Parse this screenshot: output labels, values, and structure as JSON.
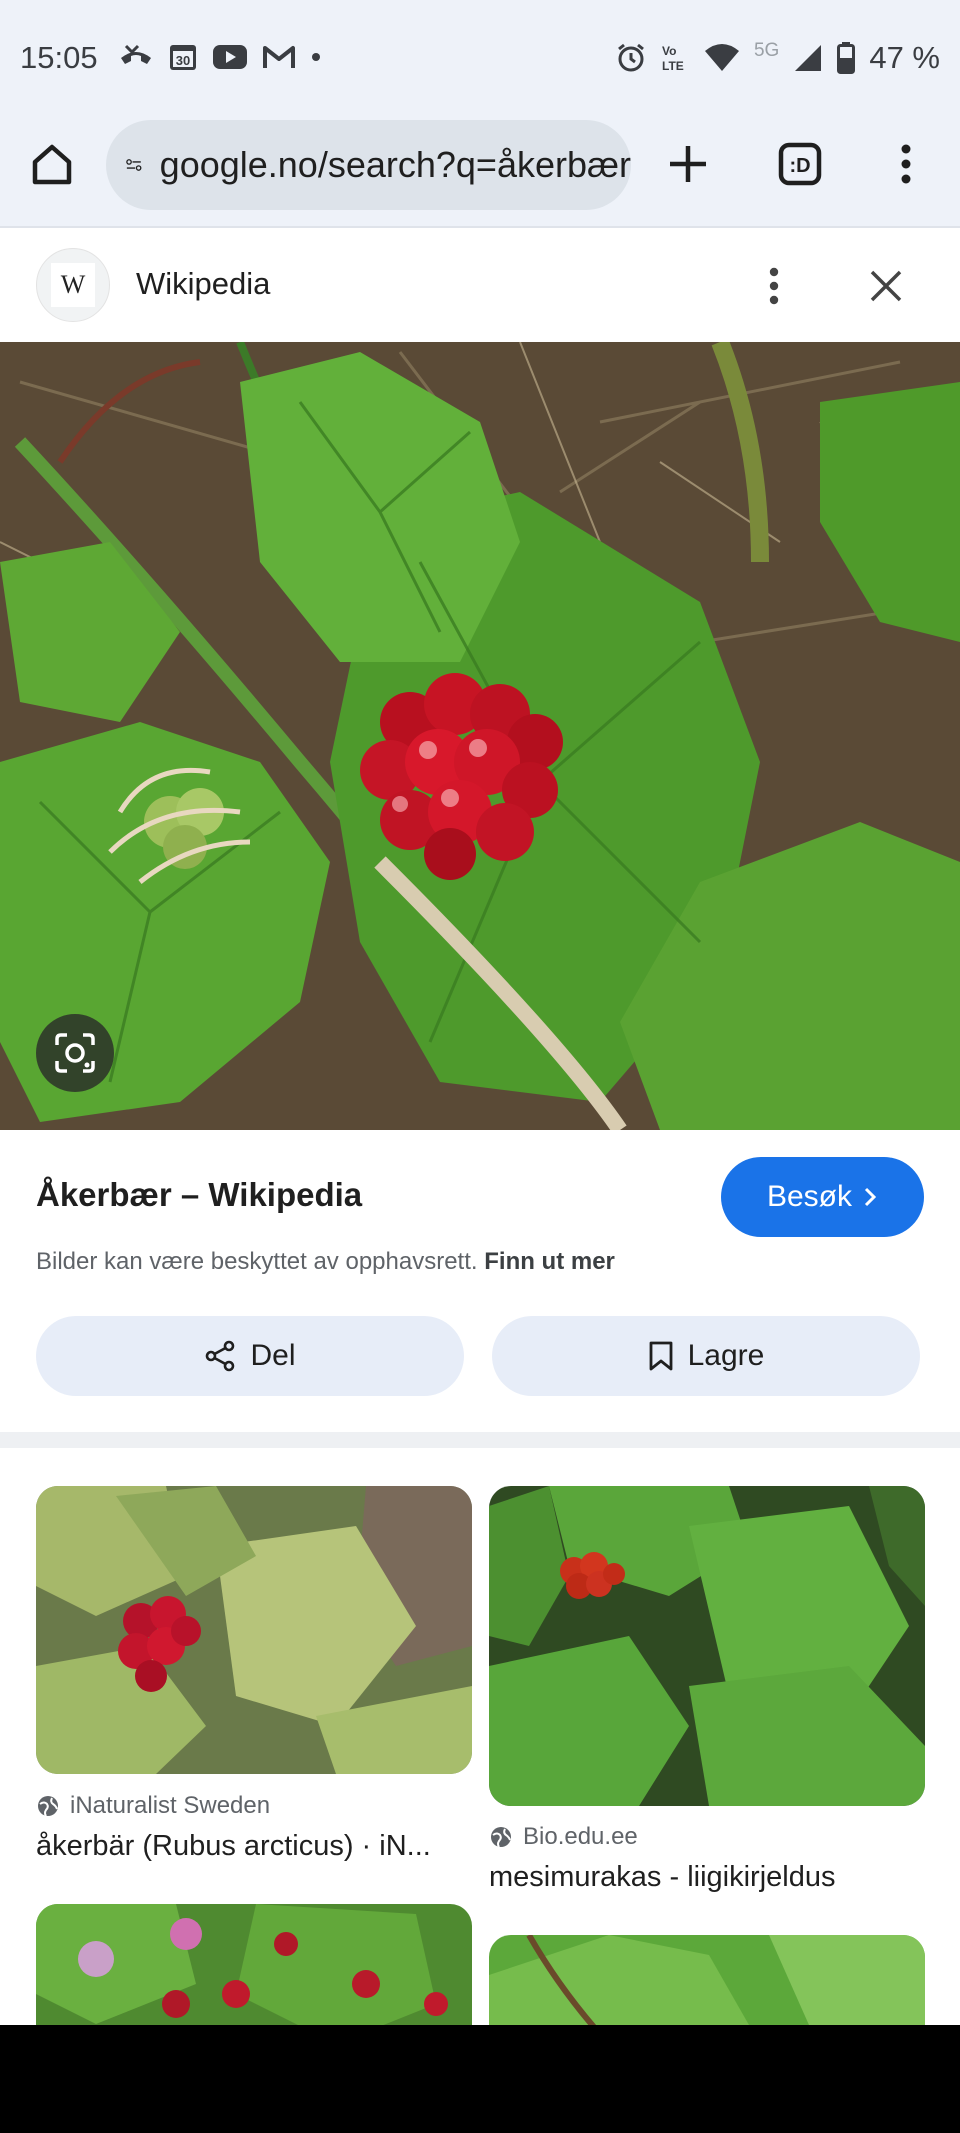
{
  "status_bar": {
    "time": "15:05",
    "calendar_day": "30",
    "network_5g": "5G",
    "battery": "47 %",
    "left_icons": [
      "missed-call-icon",
      "calendar-icon",
      "youtube-icon",
      "gmail-icon",
      "dot-icon"
    ],
    "right_icons": [
      "alarm-icon",
      "volte-icon",
      "wifi-icon",
      "signal-icon",
      "battery-icon"
    ]
  },
  "browser": {
    "url": "google.no/search?q=åkerbær",
    "tab_count_label": ":D"
  },
  "panel": {
    "source": "Wikipedia",
    "logo_letter": "W",
    "title": "Åkerbær – Wikipedia",
    "visit_label": "Besøk",
    "copyright_text": "Bilder kan være beskyttet av opphavsrett.",
    "learn_more": "Finn ut mer",
    "share_label": "Del",
    "save_label": "Lagre"
  },
  "results": [
    {
      "source": "iNaturalist Sweden",
      "title": "åkerbär (Rubus arcticus) · iN..."
    },
    {
      "source": "Bio.edu.ee",
      "title": "mesimurakas - liigikirjeldus"
    }
  ],
  "colors": {
    "accent": "#1a73e8",
    "toolbar_bg": "#eef2f9",
    "pill_bg": "#e7edf8",
    "berry_red": "#d0142a"
  }
}
